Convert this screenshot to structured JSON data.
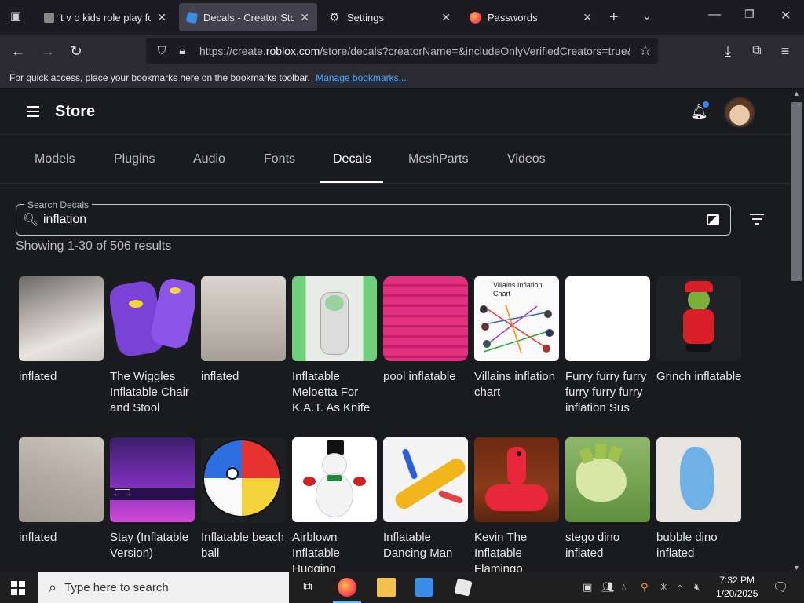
{
  "browser": {
    "tabs": [
      {
        "title": "t v o kids role play for ·",
        "active": false
      },
      {
        "title": "Decals - Creator Store",
        "active": true
      },
      {
        "title": "Settings",
        "active": false
      },
      {
        "title": "Passwords",
        "active": false
      }
    ],
    "url_prefix": "https://create.",
    "url_domain": "roblox.com",
    "url_rest": "/store/decals?creatorName=&includeOnlyVerifiedCreators=true&",
    "bookmarks_text": "For quick access, place your bookmarks here on the bookmarks toolbar.",
    "bookmarks_link": "Manage bookmarks..."
  },
  "store": {
    "title": "Store",
    "nav_tabs": [
      "Models",
      "Plugins",
      "Audio",
      "Fonts",
      "Decals",
      "MeshParts",
      "Videos"
    ],
    "active_tab": "Decals",
    "search_label": "Search Decals",
    "search_value": "inflation",
    "results_text": "Showing 1-30 of 506 results",
    "items": [
      {
        "name": "inflated"
      },
      {
        "name": "The Wiggles Inflatable Chair and Stool"
      },
      {
        "name": "inflated"
      },
      {
        "name": "Inflatable Meloetta For K.A.T. As Knife"
      },
      {
        "name": "pool inflatable"
      },
      {
        "name": "Villains inflation chart"
      },
      {
        "name": "Furry furry furry furry furry furry inflation Sus"
      },
      {
        "name": "Grinch inflatable"
      },
      {
        "name": "inflated"
      },
      {
        "name": "Stay (Inflatable Version)"
      },
      {
        "name": "Inflatable beach ball"
      },
      {
        "name": "Airblown Inflatable Hugging"
      },
      {
        "name": "Inflatable Dancing Man"
      },
      {
        "name": "Kevin The Inflatable Flamingo"
      },
      {
        "name": "stego dino inflated"
      },
      {
        "name": "bubble dino inflated"
      }
    ],
    "thumb_texts": {
      "villains_chart_title": "Villains Inflation Chart"
    }
  },
  "taskbar": {
    "search_placeholder": "Type here to search",
    "time": "7:32 PM",
    "date": "1/20/2025"
  },
  "colors": {
    "background": "#191b1f",
    "accent_link": "#4aa8ff",
    "notification_dot": "#3b82f6"
  }
}
